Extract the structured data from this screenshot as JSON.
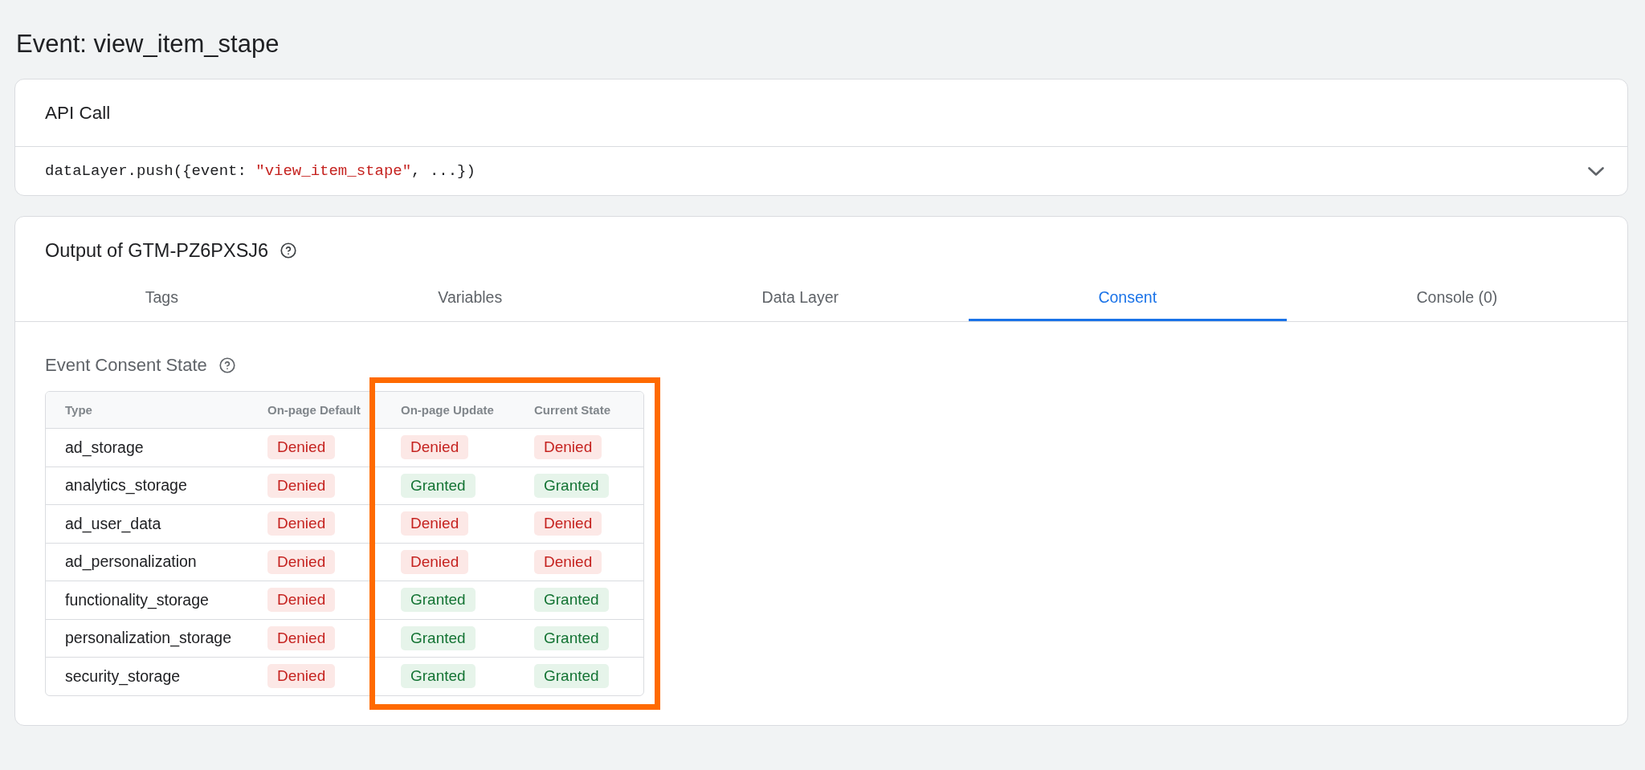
{
  "page": {
    "title": "Event: view_item_stape"
  },
  "api_call": {
    "title": "API Call",
    "code": {
      "before": "dataLayer.push({event: ",
      "string": "\"view_item_stape\"",
      "after": ", ...})"
    },
    "expanded": false
  },
  "output": {
    "title": "Output of GTM-PZ6PXSJ6",
    "tabs": [
      {
        "label": "Tags",
        "selected": false
      },
      {
        "label": "Variables",
        "selected": false
      },
      {
        "label": "Data Layer",
        "selected": false
      },
      {
        "label": "Consent",
        "selected": true
      },
      {
        "label": "Console (0)",
        "selected": false
      }
    ],
    "consent": {
      "title": "Event Consent State",
      "table": {
        "columns": [
          {
            "label": "Type",
            "highlighted": false
          },
          {
            "label": "On-page Default",
            "highlighted": false
          },
          {
            "label": "On-page Update",
            "highlighted": true
          },
          {
            "label": "Current State",
            "highlighted": true
          }
        ],
        "rows": [
          {
            "type": "ad_storage",
            "values": [
              {
                "label": "Denied",
                "granted": false
              },
              {
                "label": "Denied",
                "granted": false
              },
              {
                "label": "Denied",
                "granted": false
              }
            ]
          },
          {
            "type": "analytics_storage",
            "values": [
              {
                "label": "Denied",
                "granted": false
              },
              {
                "label": "Granted",
                "granted": true
              },
              {
                "label": "Granted",
                "granted": true
              }
            ]
          },
          {
            "type": "ad_user_data",
            "values": [
              {
                "label": "Denied",
                "granted": false
              },
              {
                "label": "Denied",
                "granted": false
              },
              {
                "label": "Denied",
                "granted": false
              }
            ]
          },
          {
            "type": "ad_personalization",
            "values": [
              {
                "label": "Denied",
                "granted": false
              },
              {
                "label": "Denied",
                "granted": false
              },
              {
                "label": "Denied",
                "granted": false
              }
            ]
          },
          {
            "type": "functionality_storage",
            "values": [
              {
                "label": "Denied",
                "granted": false
              },
              {
                "label": "Granted",
                "granted": true
              },
              {
                "label": "Granted",
                "granted": true
              }
            ]
          },
          {
            "type": "personalization_storage",
            "values": [
              {
                "label": "Denied",
                "granted": false
              },
              {
                "label": "Granted",
                "granted": true
              },
              {
                "label": "Granted",
                "granted": true
              }
            ]
          },
          {
            "type": "security_storage",
            "values": [
              {
                "label": "Denied",
                "granted": false
              },
              {
                "label": "Granted",
                "granted": true
              },
              {
                "label": "Granted",
                "granted": true
              }
            ]
          }
        ]
      }
    }
  }
}
